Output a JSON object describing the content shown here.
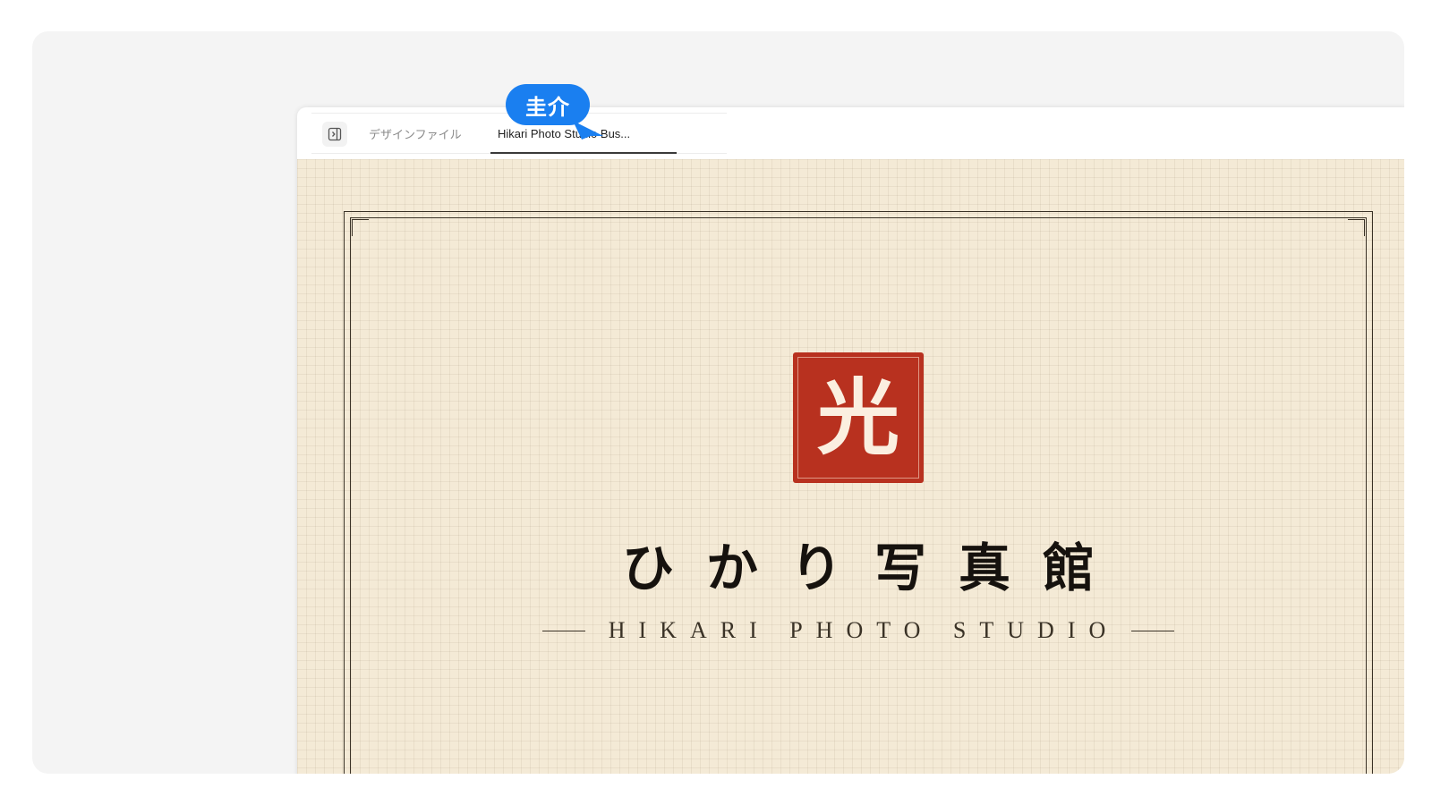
{
  "tabs": {
    "design_label": "デザインファイル",
    "active_label": "Hikari Photo Studio Bus..."
  },
  "cursor": {
    "user_name": "圭介",
    "color": "#1a7ff0"
  },
  "card": {
    "seal_char": "光",
    "seal_color": "#b8311f",
    "title_jp": "ひかり写真館",
    "subtitle_en": "HIKARI PHOTO STUDIO"
  },
  "icons": {
    "panel_toggle": "sidebar-toggle-icon",
    "cursor": "cursor-pointer-icon"
  }
}
